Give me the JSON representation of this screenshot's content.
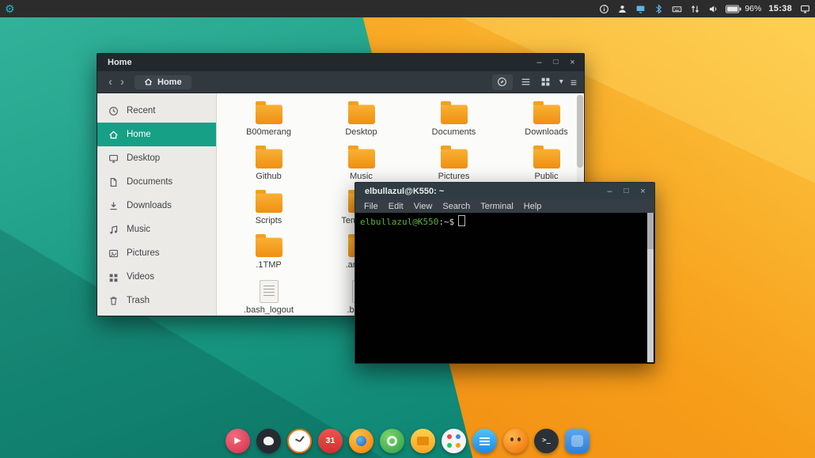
{
  "colors": {
    "accent_teal": "#16a085",
    "folder_orange": "#f39c12",
    "panel_bg": "#2c2c2c",
    "wall_teal": "#17967f",
    "wall_orange": "#f69d19"
  },
  "glyphs": {
    "minimize": "–",
    "maximize": "□",
    "close": "×",
    "back": "‹",
    "forward": "›",
    "dropdown": "▾",
    "menu": "≡"
  },
  "panel": {
    "battery_percent": "96%",
    "clock": "15:38"
  },
  "file_manager": {
    "window_title": "Home",
    "breadcrumb": "Home",
    "sidebar": {
      "items": [
        {
          "label": "Recent"
        },
        {
          "label": "Home",
          "selected": true
        },
        {
          "label": "Desktop"
        },
        {
          "label": "Documents"
        },
        {
          "label": "Downloads"
        },
        {
          "label": "Music"
        },
        {
          "label": "Pictures"
        },
        {
          "label": "Videos"
        },
        {
          "label": "Trash"
        }
      ]
    },
    "files": [
      {
        "name": "B00merang",
        "type": "folder"
      },
      {
        "name": "Desktop",
        "type": "folder"
      },
      {
        "name": "Documents",
        "type": "folder"
      },
      {
        "name": "Downloads",
        "type": "folder"
      },
      {
        "name": "Github",
        "type": "folder"
      },
      {
        "name": "Music",
        "type": "folder"
      },
      {
        "name": "Pictures",
        "type": "folder"
      },
      {
        "name": "Public",
        "type": "folder"
      },
      {
        "name": "Scripts",
        "type": "folder"
      },
      {
        "name": "Templates",
        "type": "folder"
      },
      {
        "name": ".1TMP",
        "type": "folder"
      },
      {
        "name": ".android",
        "type": "folder"
      },
      {
        "name": ".bash_logout",
        "type": "file"
      },
      {
        "name": ".bashrc",
        "type": "file"
      }
    ]
  },
  "terminal": {
    "window_title": "elbullazul@K550: ~",
    "menu": [
      {
        "label": "File"
      },
      {
        "label": "Edit"
      },
      {
        "label": "View"
      },
      {
        "label": "Search"
      },
      {
        "label": "Terminal"
      },
      {
        "label": "Help"
      }
    ],
    "prompt": {
      "user_host": "elbullazul@K550",
      "path_suffix": ":~$"
    }
  },
  "dock": {
    "items": [
      {
        "name": "media-player",
        "glyph": "▶"
      },
      {
        "name": "dark-app",
        "glyph": ""
      },
      {
        "name": "clock-app",
        "glyph": ""
      },
      {
        "name": "calendar-app",
        "glyph": "31"
      },
      {
        "name": "firefox-browser",
        "glyph": ""
      },
      {
        "name": "green-app",
        "glyph": ""
      },
      {
        "name": "folder-app",
        "glyph": ""
      },
      {
        "name": "app-center",
        "glyph": ""
      },
      {
        "name": "notes-app",
        "glyph": ""
      },
      {
        "name": "face-app",
        "glyph": ""
      },
      {
        "name": "terminal-app",
        "glyph": ">_"
      },
      {
        "name": "blue-app",
        "glyph": ""
      }
    ]
  }
}
